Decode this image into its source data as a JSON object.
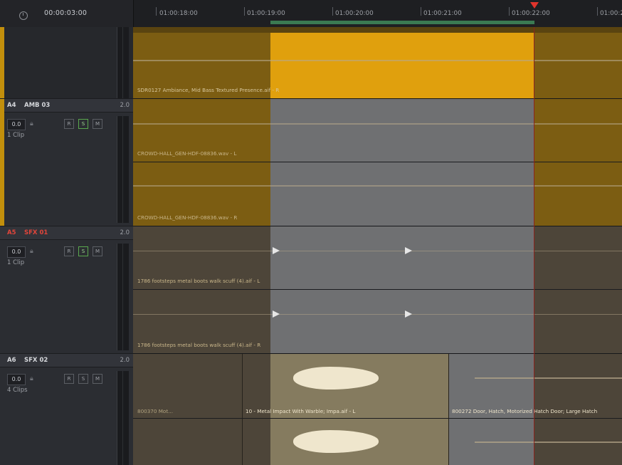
{
  "timecode": "00:00:03:00",
  "ruler": [
    "01:00:18:00",
    "01:00:19:00",
    "01:00:20:00",
    "01:00:21:00",
    "01:00:22:00",
    "01:00:2"
  ],
  "tracks": [
    {
      "id": "A4",
      "name": "AMB 03",
      "channels": "2.0",
      "volume": "0.0",
      "r": "R",
      "s": "S",
      "m": "M",
      "clips_count": "1 Clip"
    },
    {
      "id": "A5",
      "name": "SFX 01",
      "channels": "2.0",
      "volume": "0.0",
      "r": "R",
      "s": "S",
      "m": "M",
      "clips_count": "1 Clip"
    },
    {
      "id": "A6",
      "name": "SFX 02",
      "channels": "2.0",
      "volume": "0.0",
      "r": "R",
      "s": "S",
      "m": "M",
      "clips_count": "4 Clips"
    }
  ],
  "clips": {
    "top": "SDR0127 Ambiance, Mid Bass Textured Presence.aif - R",
    "amb_l": "CROWD-HALL_GEN-HDF-08836.wav - L",
    "amb_r": "CROWD-HALL_GEN-HDF-08836.wav - R",
    "sfx01_l": "1786 footsteps metal boots walk scuff (4).aif - L",
    "sfx01_r": "1786 footsteps metal boots walk scuff (4).aif - R",
    "sfx02_a": "800370 Mot...",
    "sfx02_b": "10 - Metal Impact With Warble; Impa.aif - L",
    "sfx02_c": "800272 Door, Hatch, Motorized Hatch Door; Large Hatch"
  },
  "colors": {
    "amber": "#c28f0c",
    "amber_bright": "#e3a10d",
    "grey_sel": "#6f7072",
    "brown": "#5a4c34",
    "playhead": "#e0342c",
    "range": "#3b7a52"
  }
}
